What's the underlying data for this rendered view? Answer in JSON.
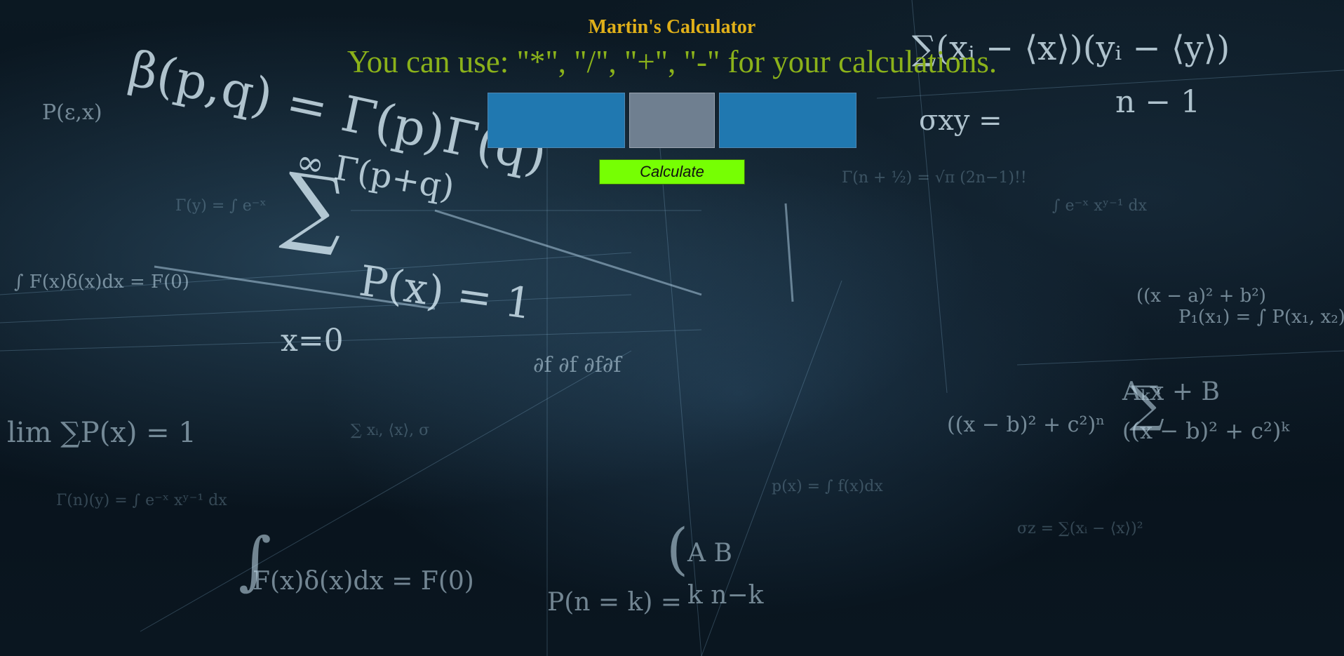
{
  "header": {
    "title": "Martin's Calculator",
    "hint": "You can use: \"*\", \"/\", \"+\", \"-\" for your calculations."
  },
  "form": {
    "first_number_value": "",
    "operator_value": "",
    "second_number_value": "",
    "calculate_label": "Calculate"
  },
  "colors": {
    "title": "#e0b019",
    "hint": "#8bb21a",
    "number_input_bg": "#2078b0",
    "operator_input_bg": "#6f7f90",
    "button_bg": "#76ff03"
  }
}
